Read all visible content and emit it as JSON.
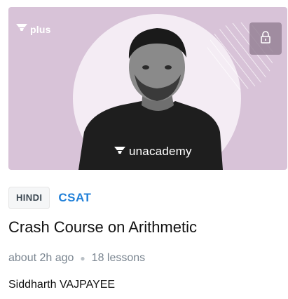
{
  "thumbnail": {
    "plus_label": "plus",
    "brand_label": "unacademy",
    "icons": {
      "plus_logo": "unacademy-logo-icon",
      "lock": "lock-icon",
      "brand_logo": "unacademy-logo-icon"
    },
    "colors": {
      "background": "#d8c3d8",
      "circle": "#f4ecf4",
      "shirt": "#1e1e1e"
    }
  },
  "course": {
    "language": "HINDI",
    "subject": "CSAT",
    "title": "Crash Course on Arithmetic",
    "updated": "about 2h ago",
    "lessons": "18 lessons",
    "author": "Siddharth VAJPAYEE"
  },
  "colors": {
    "subject_accent": "#1f7fd8",
    "meta_text": "#7a8590"
  }
}
